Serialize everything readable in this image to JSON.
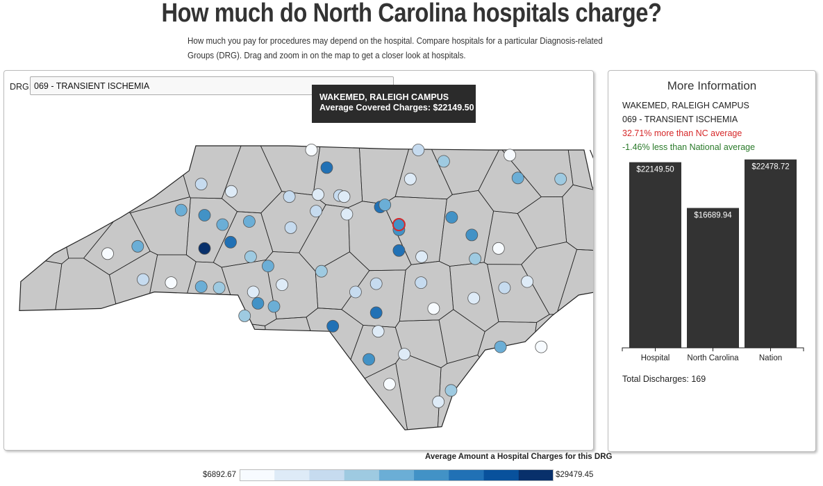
{
  "page": {
    "title": "How much do North Carolina hospitals charge?",
    "intro": "How much you pay for procedures may depend on the hospital. Compare hospitals for a particular Diagnosis-related Groups (DRG). Drag and zoom in on the map to get a closer look at hospitals."
  },
  "drg": {
    "label": "DRG:",
    "selected": "069 - TRANSIENT ISCHEMIA"
  },
  "tooltip": {
    "hospital": "WAKEMED, RALEIGH CAMPUS",
    "charges": "Average Covered Charges: $22149.50"
  },
  "info": {
    "title": "More Information",
    "hospital": "WAKEMED, RALEIGH CAMPUS",
    "drg": "069 - TRANSIENT ISCHEMIA",
    "nc_comparison": "32.71% more than NC average",
    "national_comparison": "-1.46% less than National average",
    "discharges": "Total Discharges: 169"
  },
  "chart_data": {
    "type": "bar",
    "categories": [
      "Hospital",
      "North Carolina",
      "Nation"
    ],
    "values": [
      22149.5,
      16689.94,
      22478.72
    ],
    "value_labels": [
      "$22149.50",
      "$16689.94",
      "$22478.72"
    ],
    "ylim": [
      0,
      22700
    ],
    "bar_color": "#333333"
  },
  "legend": {
    "title": "Average Amount a Hospital Charges for this DRG",
    "min": "$6892.67",
    "max": "$29479.45",
    "colors": [
      "#f7fbff",
      "#deebf7",
      "#c6dbef",
      "#9ecae1",
      "#6baed6",
      "#4292c6",
      "#2171b5",
      "#08519c",
      "#08306b"
    ]
  },
  "map": {
    "county_fill": "#c8c8c8",
    "selected_stroke": "#d62728"
  },
  "hospitals": [
    {
      "lat": 36.55,
      "lon": -79.95,
      "level": 0
    },
    {
      "lat": 36.55,
      "lon": -78.35,
      "level": 2
    },
    {
      "lat": 36.44,
      "lon": -77.97,
      "level": 3
    },
    {
      "lat": 36.5,
      "lon": -76.98,
      "level": 0
    },
    {
      "lat": 36.38,
      "lon": -79.72,
      "level": 6
    },
    {
      "lat": 36.22,
      "lon": -81.6,
      "level": 2
    },
    {
      "lat": 36.15,
      "lon": -81.15,
      "level": 1
    },
    {
      "lat": 36.1,
      "lon": -80.28,
      "level": 2
    },
    {
      "lat": 36.12,
      "lon": -79.85,
      "level": 1
    },
    {
      "lat": 36.11,
      "lon": -79.53,
      "level": 2
    },
    {
      "lat": 36.1,
      "lon": -79.46,
      "level": 1
    },
    {
      "lat": 36.27,
      "lon": -78.47,
      "level": 1
    },
    {
      "lat": 36.28,
      "lon": -76.86,
      "level": 4
    },
    {
      "lat": 36.27,
      "lon": -76.22,
      "level": 3
    },
    {
      "lat": 35.97,
      "lon": -81.9,
      "level": 4
    },
    {
      "lat": 35.92,
      "lon": -81.55,
      "level": 5
    },
    {
      "lat": 35.83,
      "lon": -81.28,
      "level": 4
    },
    {
      "lat": 35.86,
      "lon": -80.88,
      "level": 4
    },
    {
      "lat": 35.93,
      "lon": -79.42,
      "level": 1
    },
    {
      "lat": 35.96,
      "lon": -79.88,
      "level": 2
    },
    {
      "lat": 36.0,
      "lon": -78.92,
      "level": 6
    },
    {
      "lat": 36.02,
      "lon": -78.85,
      "level": 4
    },
    {
      "lat": 35.8,
      "lon": -80.26,
      "level": 2
    },
    {
      "lat": 35.78,
      "lon": -78.64,
      "level": 5
    },
    {
      "lat": 35.9,
      "lon": -77.85,
      "level": 5
    },
    {
      "lat": 35.73,
      "lon": -77.55,
      "level": 5
    },
    {
      "lat": 35.6,
      "lon": -77.15,
      "level": 0
    },
    {
      "lat": 35.62,
      "lon": -82.55,
      "level": 4
    },
    {
      "lat": 35.6,
      "lon": -81.55,
      "level": 8
    },
    {
      "lat": 35.66,
      "lon": -81.16,
      "level": 6
    },
    {
      "lat": 35.52,
      "lon": -80.86,
      "level": 3
    },
    {
      "lat": 35.43,
      "lon": -80.6,
      "level": 4
    },
    {
      "lat": 35.55,
      "lon": -83.0,
      "level": 0
    },
    {
      "lat": 35.58,
      "lon": -78.64,
      "level": 6
    },
    {
      "lat": 35.52,
      "lon": -78.3,
      "level": 1
    },
    {
      "lat": 35.5,
      "lon": -77.5,
      "level": 3
    },
    {
      "lat": 35.27,
      "lon": -82.05,
      "level": 0
    },
    {
      "lat": 35.3,
      "lon": -82.47,
      "level": 2
    },
    {
      "lat": 35.23,
      "lon": -81.6,
      "level": 4
    },
    {
      "lat": 35.22,
      "lon": -81.33,
      "level": 3
    },
    {
      "lat": 35.18,
      "lon": -80.82,
      "level": 1
    },
    {
      "lat": 35.25,
      "lon": -80.39,
      "level": 1
    },
    {
      "lat": 35.38,
      "lon": -79.8,
      "level": 3
    },
    {
      "lat": 35.07,
      "lon": -80.75,
      "level": 5
    },
    {
      "lat": 35.04,
      "lon": -80.51,
      "level": 4
    },
    {
      "lat": 34.95,
      "lon": -80.95,
      "level": 3
    },
    {
      "lat": 35.18,
      "lon": -79.29,
      "level": 2
    },
    {
      "lat": 35.26,
      "lon": -78.98,
      "level": 2
    },
    {
      "lat": 35.27,
      "lon": -78.31,
      "level": 2
    },
    {
      "lat": 35.22,
      "lon": -77.06,
      "level": 2
    },
    {
      "lat": 35.28,
      "lon": -76.72,
      "level": 1
    },
    {
      "lat": 35.12,
      "lon": -77.52,
      "level": 1
    },
    {
      "lat": 34.98,
      "lon": -78.98,
      "level": 6
    },
    {
      "lat": 34.85,
      "lon": -79.63,
      "level": 6
    },
    {
      "lat": 35.02,
      "lon": -78.12,
      "level": 0
    },
    {
      "lat": 34.8,
      "lon": -78.95,
      "level": 1
    },
    {
      "lat": 34.65,
      "lon": -77.12,
      "level": 4
    },
    {
      "lat": 34.65,
      "lon": -76.51,
      "level": 0
    },
    {
      "lat": 34.53,
      "lon": -79.09,
      "level": 5
    },
    {
      "lat": 34.58,
      "lon": -78.56,
      "level": 1
    },
    {
      "lat": 34.29,
      "lon": -78.78,
      "level": 0
    },
    {
      "lat": 34.23,
      "lon": -77.86,
      "level": 3
    },
    {
      "lat": 34.12,
      "lon": -78.05,
      "level": 1
    }
  ],
  "selected_hospital": {
    "lat": 35.83,
    "lon": -78.64
  }
}
